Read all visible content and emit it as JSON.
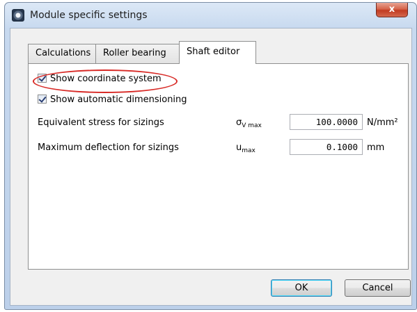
{
  "window": {
    "title": "Module specific settings",
    "close_glyph": "x",
    "icon": "app-icon"
  },
  "tabs": [
    {
      "label": "Calculations",
      "active": false
    },
    {
      "label": "Roller bearing",
      "active": false
    },
    {
      "label": "Shaft editor",
      "active": true
    }
  ],
  "options": {
    "show_coordinate_system": {
      "label": "Show coordinate system",
      "checked": true,
      "highlighted": true
    },
    "show_automatic_dimensioning": {
      "label": "Show automatic dimensioning",
      "checked": true
    }
  },
  "fields": [
    {
      "label": "Equivalent stress for sizings",
      "symbol": "σ",
      "symbol_sub": "V max",
      "value": "100.0000",
      "unit": "N/mm²"
    },
    {
      "label": "Maximum deflection for sizings",
      "symbol": "u",
      "symbol_sub": "max",
      "value": "0.1000",
      "unit": "mm"
    }
  ],
  "buttons": {
    "ok": "OK",
    "cancel": "Cancel"
  },
  "colors": {
    "highlight": "#d82a26",
    "close_button": "#c13b22"
  }
}
